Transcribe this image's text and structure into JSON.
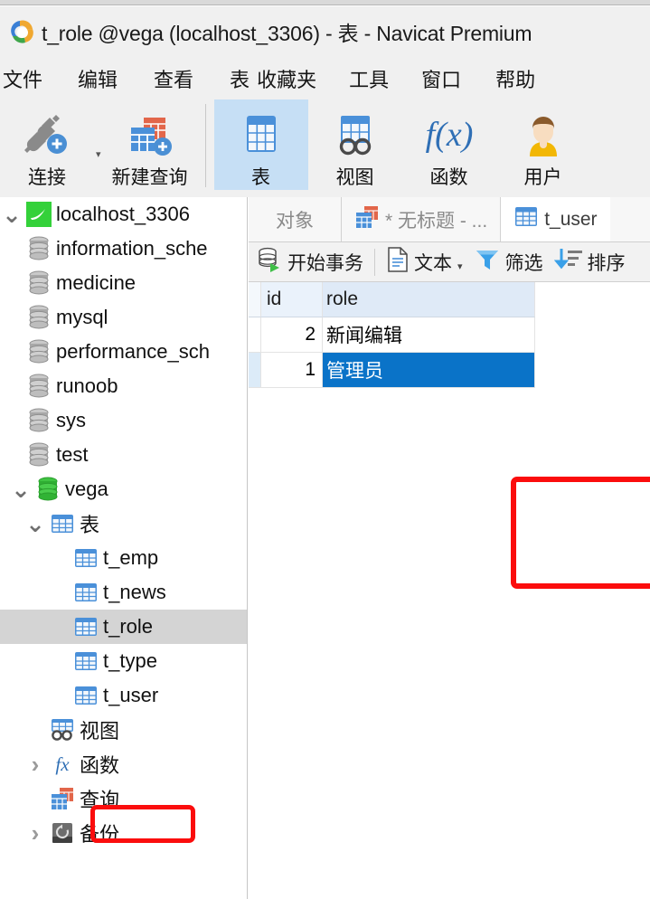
{
  "window": {
    "title": "t_role @vega (localhost_3306) - 表 - Navicat Premium",
    "logo_icon": "navicat-logo-icon"
  },
  "menubar": {
    "items": [
      {
        "label": "文件",
        "name": "menu-file"
      },
      {
        "label": "编辑",
        "name": "menu-edit"
      },
      {
        "label": "查看",
        "name": "menu-view"
      },
      {
        "label": "表",
        "name": "menu-table"
      },
      {
        "label": "收藏夹",
        "name": "menu-favorites"
      },
      {
        "label": "工具",
        "name": "menu-tools"
      },
      {
        "label": "窗口",
        "name": "menu-window"
      },
      {
        "label": "帮助",
        "name": "menu-help"
      }
    ]
  },
  "toolbar": {
    "buttons": [
      {
        "label": "连接",
        "icon": "connection-plug-icon",
        "active": false
      },
      {
        "label": "新建查询",
        "icon": "new-query-icon",
        "active": false
      },
      {
        "label": "表",
        "icon": "table-icon",
        "active": true
      },
      {
        "label": "视图",
        "icon": "view-glasses-icon",
        "active": false
      },
      {
        "label": "函数",
        "icon": "function-fx-icon",
        "active": false
      },
      {
        "label": "用户",
        "icon": "user-avatar-icon",
        "active": false
      }
    ]
  },
  "sidebar": {
    "tree": [
      {
        "label": "localhost_3306",
        "level": 1,
        "twisty": "down",
        "icon": "mysql-server-icon",
        "selected": false
      },
      {
        "label": "information_sche",
        "level": 2,
        "twisty": "none",
        "icon": "database-gray-icon",
        "selected": false
      },
      {
        "label": "medicine",
        "level": 2,
        "twisty": "none",
        "icon": "database-gray-icon",
        "selected": false
      },
      {
        "label": "mysql",
        "level": 2,
        "twisty": "none",
        "icon": "database-gray-icon",
        "selected": false
      },
      {
        "label": "performance_sch",
        "level": 2,
        "twisty": "none",
        "icon": "database-gray-icon",
        "selected": false
      },
      {
        "label": "runoob",
        "level": 2,
        "twisty": "none",
        "icon": "database-gray-icon",
        "selected": false
      },
      {
        "label": "sys",
        "level": 2,
        "twisty": "none",
        "icon": "database-gray-icon",
        "selected": false
      },
      {
        "label": "test",
        "level": 2,
        "twisty": "none",
        "icon": "database-gray-icon",
        "selected": false
      },
      {
        "label": "vega",
        "level": 2,
        "twisty": "down",
        "icon": "database-green-icon",
        "selected": false
      },
      {
        "label": "表",
        "level": 3,
        "twisty": "down",
        "icon": "table-folder-icon",
        "selected": false
      },
      {
        "label": "t_emp",
        "level": 4,
        "twisty": "none",
        "icon": "table-icon",
        "selected": false
      },
      {
        "label": "t_news",
        "level": 4,
        "twisty": "none",
        "icon": "table-icon",
        "selected": false
      },
      {
        "label": "t_role",
        "level": 4,
        "twisty": "none",
        "icon": "table-icon",
        "selected": true
      },
      {
        "label": "t_type",
        "level": 4,
        "twisty": "none",
        "icon": "table-icon",
        "selected": false
      },
      {
        "label": "t_user",
        "level": 4,
        "twisty": "none",
        "icon": "table-icon",
        "selected": false
      },
      {
        "label": "视图",
        "level": 3,
        "twisty": "none",
        "icon": "view-glasses-icon",
        "selected": false
      },
      {
        "label": "函数",
        "level": 3,
        "twisty": "right",
        "icon": "function-fx-icon",
        "selected": false
      },
      {
        "label": "查询",
        "level": 3,
        "twisty": "none",
        "icon": "query-icon",
        "selected": false
      },
      {
        "label": "备份",
        "level": 3,
        "twisty": "right",
        "icon": "backup-disk-icon",
        "selected": false
      }
    ]
  },
  "main": {
    "tabs": [
      {
        "label": "对象",
        "icon": null,
        "state": "inactive",
        "name": "tab-objects"
      },
      {
        "label": "* 无标题 - ...",
        "icon": "query-icon",
        "state": "inactive",
        "name": "tab-untitled-query"
      },
      {
        "label": "t_user",
        "icon": "table-icon",
        "state": "current",
        "name": "tab-t-user"
      }
    ],
    "gridbar": [
      {
        "label": "开始事务",
        "icon": "begin-transaction-icon",
        "caret": false,
        "name": "begin-transaction-button"
      },
      {
        "label": "文本",
        "icon": "text-document-icon",
        "caret": true,
        "name": "text-button"
      },
      {
        "label": "筛选",
        "icon": "filter-funnel-icon",
        "caret": false,
        "name": "filter-button"
      },
      {
        "label": "排序",
        "icon": "sort-descending-icon",
        "caret": false,
        "name": "sort-button"
      }
    ],
    "grid": {
      "columns": [
        "id",
        "role"
      ],
      "rows": [
        {
          "id": "2",
          "role": "新闻编辑",
          "selected": false
        },
        {
          "id": "1",
          "role": "管理员",
          "selected": true
        }
      ]
    }
  },
  "annotations": [
    {
      "name": "annotation-box-tree-t-role",
      "color": "#fb0d0d"
    },
    {
      "name": "annotation-box-grid",
      "color": "#fb0d0d"
    }
  ],
  "colors": {
    "accent_blue": "#0a73c8",
    "toolbar_active": "#c6dff5",
    "annotation_red": "#fb0d0d",
    "tree_selected": "#d4d4d4",
    "header_blue": "#dfeaf7"
  }
}
